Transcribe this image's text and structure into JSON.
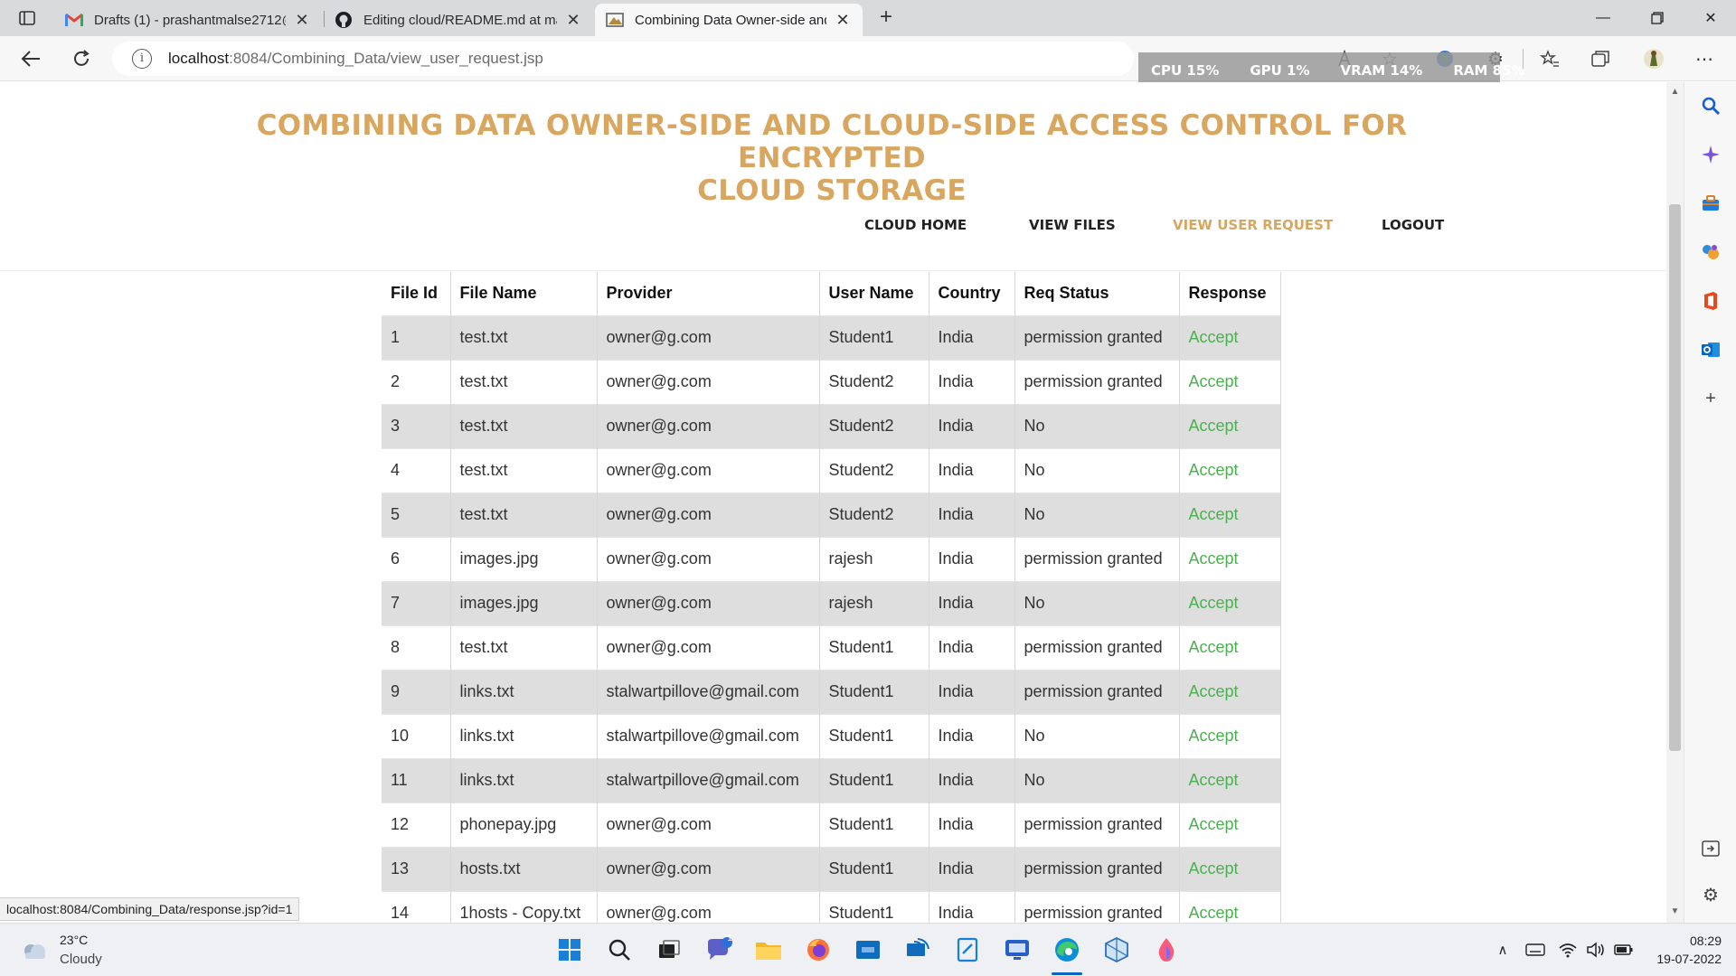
{
  "browser": {
    "tabs": [
      {
        "title": "Drafts (1) - prashantmalse2712@",
        "icon": "gmail-icon",
        "active": false
      },
      {
        "title": "Editing cloud/README.md at ma",
        "icon": "github-icon",
        "active": false
      },
      {
        "title": "Combining Data Owner-side and",
        "icon": "site-favicon-icon",
        "active": true
      }
    ],
    "new_tab": "+",
    "url_host": "localhost",
    "url_path": ":8084/Combining_Data/view_user_request.jsp",
    "status_url": "localhost:8084/Combining_Data/response.jsp?id=1"
  },
  "perf_overlay": {
    "cpu": "CPU  15%",
    "gpu": "GPU   1%",
    "vram": "VRAM  14%",
    "ram": "RAM  85%"
  },
  "site": {
    "title_line1": "COMBINING DATA OWNER-SIDE AND CLOUD-SIDE ACCESS CONTROL FOR ENCRYPTED",
    "title_line2": "CLOUD STORAGE",
    "accent_color": "#d8a65e",
    "menu": [
      {
        "label": "CLOUD HOME",
        "active": false
      },
      {
        "label": "VIEW FILES",
        "active": false
      },
      {
        "label": "VIEW USER REQUEST",
        "active": true
      },
      {
        "label": "LOGOUT",
        "active": false
      }
    ]
  },
  "table": {
    "columns": [
      "File Id",
      "File Name",
      "Provider",
      "User Name",
      "Country",
      "Req Status",
      "Response"
    ],
    "rows": [
      [
        "1",
        "test.txt",
        "owner@g.com",
        "Student1",
        "India",
        "permission granted",
        "Accept"
      ],
      [
        "2",
        "test.txt",
        "owner@g.com",
        "Student2",
        "India",
        "permission granted",
        "Accept"
      ],
      [
        "3",
        "test.txt",
        "owner@g.com",
        "Student2",
        "India",
        "No",
        "Accept"
      ],
      [
        "4",
        "test.txt",
        "owner@g.com",
        "Student2",
        "India",
        "No",
        "Accept"
      ],
      [
        "5",
        "test.txt",
        "owner@g.com",
        "Student2",
        "India",
        "No",
        "Accept"
      ],
      [
        "6",
        "images.jpg",
        "owner@g.com",
        "rajesh",
        "India",
        "permission granted",
        "Accept"
      ],
      [
        "7",
        "images.jpg",
        "owner@g.com",
        "rajesh",
        "India",
        "No",
        "Accept"
      ],
      [
        "8",
        "test.txt",
        "owner@g.com",
        "Student1",
        "India",
        "permission granted",
        "Accept"
      ],
      [
        "9",
        "links.txt",
        "stalwartpillove@gmail.com",
        "Student1",
        "India",
        "permission granted",
        "Accept"
      ],
      [
        "10",
        "links.txt",
        "stalwartpillove@gmail.com",
        "Student1",
        "India",
        "No",
        "Accept"
      ],
      [
        "11",
        "links.txt",
        "stalwartpillove@gmail.com",
        "Student1",
        "India",
        "No",
        "Accept"
      ],
      [
        "12",
        "phonepay.jpg",
        "owner@g.com",
        "Student1",
        "India",
        "permission granted",
        "Accept"
      ],
      [
        "13",
        "hosts.txt",
        "owner@g.com",
        "Student1",
        "India",
        "permission granted",
        "Accept"
      ],
      [
        "14",
        "1hosts - Copy.txt",
        "owner@g.com",
        "Student1",
        "India",
        "permission granted",
        "Accept"
      ]
    ],
    "accept_color": "#4caf50"
  },
  "taskbar": {
    "weather_temp": "23°C",
    "weather_cond": "Cloudy",
    "chat_badge": "1",
    "time": "08:29",
    "date": "19-07-2022"
  }
}
